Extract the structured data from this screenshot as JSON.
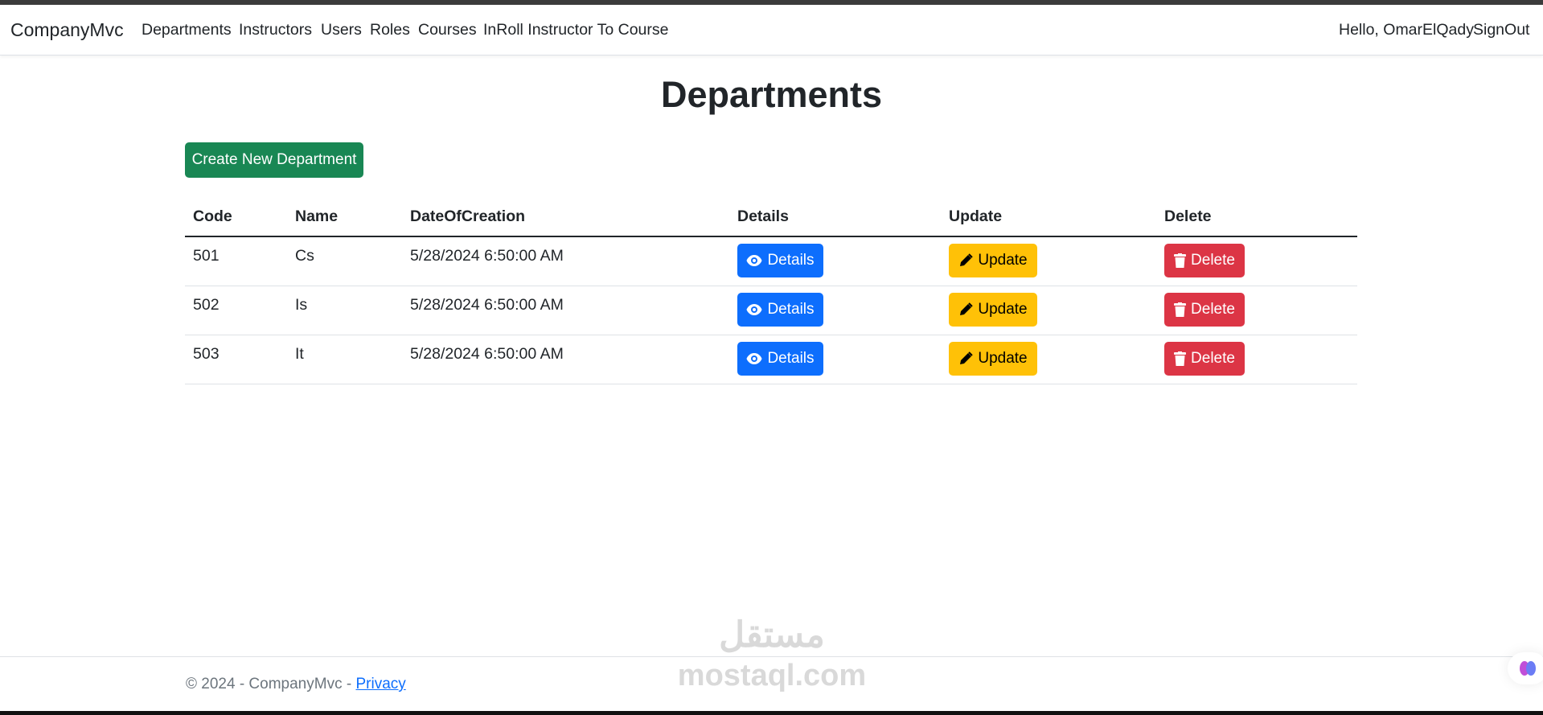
{
  "navbar": {
    "brand": "CompanyMvc",
    "links": [
      "Departments",
      "Instructors",
      "Users",
      "Roles",
      "Courses",
      "InRoll Instructor To Course"
    ],
    "greeting": "Hello, OmarElQady",
    "signout": "SignOut"
  },
  "page": {
    "title": "Departments",
    "create_label": "Create New Department"
  },
  "table": {
    "headers": [
      "Code",
      "Name",
      "DateOfCreation",
      "Details",
      "Update",
      "Delete"
    ],
    "rows": [
      {
        "code": "501",
        "name": "Cs",
        "date": "5/28/2024 6:50:00 AM"
      },
      {
        "code": "502",
        "name": "Is",
        "date": "5/28/2024 6:50:00 AM"
      },
      {
        "code": "503",
        "name": "It",
        "date": "5/28/2024 6:50:00 AM"
      }
    ],
    "details_label": "Details",
    "update_label": "Update",
    "delete_label": "Delete"
  },
  "footer": {
    "text": "© 2024 - CompanyMvc - ",
    "privacy": "Privacy"
  },
  "watermark": {
    "arabic": "مستقل",
    "latin": "mostaql.com"
  },
  "colors": {
    "primary": "#0d6efd",
    "warning": "#ffc107",
    "danger": "#dc3545",
    "success": "#198754"
  }
}
